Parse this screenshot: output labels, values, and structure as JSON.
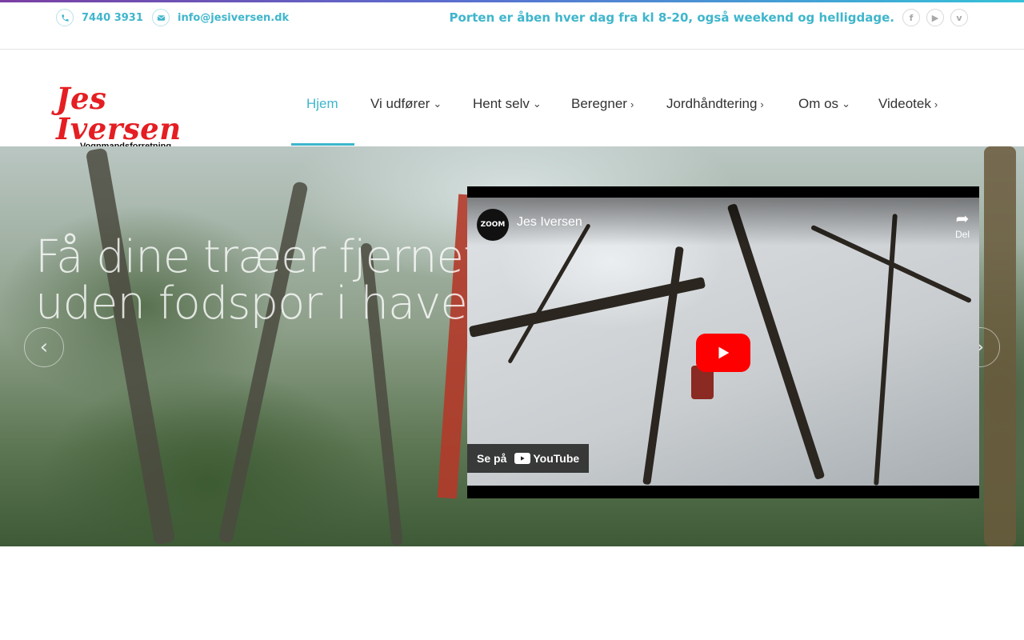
{
  "topbar": {
    "phone": "7440 3931",
    "email": "info@jesiversen.dk",
    "opening_hours": "Porten er åben hver dag fra kl 8-20, også weekend og helligdage.",
    "social": [
      {
        "icon": "facebook-icon",
        "glyph": "f"
      },
      {
        "icon": "youtube-icon",
        "glyph": "▶"
      },
      {
        "icon": "vimeo-icon",
        "glyph": "v"
      }
    ]
  },
  "logo": {
    "name": "Jes Iversen",
    "subtitle": "Vognmandsforretning"
  },
  "nav": {
    "items": [
      {
        "label": "Hjem",
        "active": true
      },
      {
        "label": "Vi udfører",
        "indicator": "chevron-down"
      },
      {
        "label": "Hent selv",
        "indicator": "chevron-down"
      },
      {
        "label": "Beregner",
        "indicator": "chevron-right"
      },
      {
        "label": "Jordhåndtering",
        "indicator": "chevron-right"
      },
      {
        "label": "Om os",
        "indicator": "chevron-down"
      },
      {
        "label": "Videotek",
        "indicator": "chevron-right"
      }
    ]
  },
  "hero": {
    "title_line1": "Få dine træer fjernet",
    "title_line2": "uden fodspor i haven."
  },
  "video": {
    "channel_avatar": "ZOOM",
    "channel_name": "Jes Iversen",
    "share_label": "Del",
    "watch_on": "Se på",
    "youtube_label": "YouTube"
  },
  "colors": {
    "accent": "#3fb6cc",
    "logo_red": "#e41e22",
    "youtube_red": "#ff0000"
  }
}
